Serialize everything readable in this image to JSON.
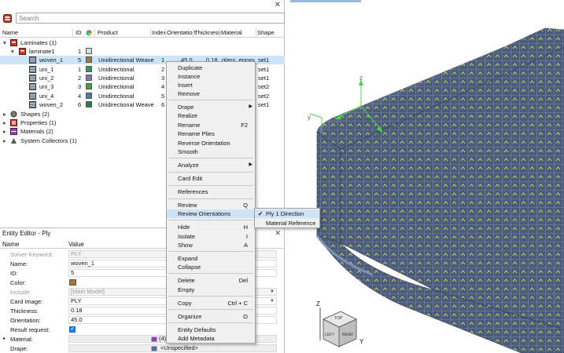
{
  "browser": {
    "close_glyph": "✕",
    "search_placeholder": "Search",
    "columns": [
      "Name",
      "ID",
      "Product",
      "Index",
      "Orientation",
      "Thickness",
      "Material",
      "Shape"
    ],
    "tree": {
      "laminates": "Laminates (1)",
      "laminate1": "laminate1",
      "laminate1_id": "1",
      "plies": [
        {
          "name": "woven_1",
          "id": "5",
          "product": "Unidirectional Weave",
          "index": "1",
          "orientation": "45.0",
          "thickness": "0.18",
          "material": "glass_epoxy",
          "shape": "set1",
          "color": "#a5793f"
        },
        {
          "name": "uni_1",
          "id": "1",
          "product": "Unidirectional",
          "index": "2",
          "orientation": "",
          "thickness": "",
          "material": "",
          "shape": "set1",
          "color": "#2f9a5a"
        },
        {
          "name": "uni_2",
          "id": "2",
          "product": "Unidirectional",
          "index": "3",
          "orientation": "",
          "thickness": "",
          "material": "",
          "shape": "set1",
          "color": "#8476b4"
        },
        {
          "name": "uni_3",
          "id": "3",
          "product": "Unidirectional",
          "index": "4",
          "orientation": "",
          "thickness": "",
          "material": "",
          "shape": "set2",
          "color": "#3fa635"
        },
        {
          "name": "uni_4",
          "id": "4",
          "product": "Unidirectional",
          "index": "5",
          "orientation": "",
          "thickness": "",
          "material": "",
          "shape": "set2",
          "color": "#5a76a8"
        },
        {
          "name": "woven_2",
          "id": "6",
          "product": "Unidirectional Weave",
          "index": "6",
          "orientation": "",
          "thickness": "",
          "material": "",
          "shape": "set1",
          "color": "#2a7a55"
        }
      ],
      "shapes": "Shapes (2)",
      "properties": "Properties (1)",
      "materials": "Materials (2)",
      "collectors": "System Collectors (1)"
    }
  },
  "editor": {
    "title": "Entity Editor - Ply",
    "close_glyph": "✕",
    "col_name": "Name",
    "col_value": "Value",
    "rows": [
      {
        "label": "Solver Keyword:",
        "value": "PLY"
      },
      {
        "label": "Name:",
        "value": "woven_1"
      },
      {
        "label": "ID:",
        "value": "5"
      },
      {
        "label": "Color:",
        "value": ""
      },
      {
        "label": "Include:",
        "value": "[Main Model]"
      },
      {
        "label": "Card Image:",
        "value": "PLY"
      },
      {
        "label": "Thickness:",
        "value": "0.18"
      },
      {
        "label": "Orientation:",
        "value": "45.0"
      },
      {
        "label": "Result request:",
        "value": ""
      },
      {
        "label": "Material:",
        "value": "(4)"
      },
      {
        "label": "Drape:",
        "value": "<Unspecified>"
      }
    ],
    "color_swatch": "#a5793f"
  },
  "context_menu": {
    "items": [
      {
        "label": "Duplicate",
        "key": ""
      },
      {
        "label": "Instance",
        "key": ""
      },
      {
        "label": "Insert",
        "key": ""
      },
      {
        "label": "Remove",
        "key": ""
      },
      {
        "label": "Drape",
        "key": ""
      },
      {
        "label": "Realize",
        "key": ""
      },
      {
        "label": "Rename",
        "key": "F2"
      },
      {
        "label": "Rename Plies",
        "key": ""
      },
      {
        "label": "Reverse Orientation",
        "key": ""
      },
      {
        "label": "Smooth",
        "key": ""
      },
      {
        "label": "Analyze",
        "key": ""
      },
      {
        "label": "Card Edit",
        "key": ""
      },
      {
        "label": "References",
        "key": ""
      },
      {
        "label": "Review",
        "key": "Q"
      },
      {
        "label": "Review Orientations",
        "key": ""
      },
      {
        "label": "Hide",
        "key": "H"
      },
      {
        "label": "Isolate",
        "key": "I"
      },
      {
        "label": "Show",
        "key": "A"
      },
      {
        "label": "Expand",
        "key": ""
      },
      {
        "label": "Collapse",
        "key": ""
      },
      {
        "label": "Delete",
        "key": "Del"
      },
      {
        "label": "Empty",
        "key": ""
      },
      {
        "label": "Copy",
        "key": "Ctrl + C"
      },
      {
        "label": "Organize",
        "key": "O"
      },
      {
        "label": "Entity Defaults",
        "key": ""
      },
      {
        "label": "Add Metadata",
        "key": ""
      }
    ],
    "arrow_glyph": "▶"
  },
  "submenu": {
    "check_glyph": "✔",
    "items": [
      "Ply 1 Direction",
      "Material Reference"
    ]
  },
  "viewport": {
    "axis_z": "z",
    "axis_y": "y",
    "axis_x": "x",
    "triad_z": "Z",
    "triad_y": "Y",
    "viewcube": [
      "TOP",
      "LEFT",
      "REAR"
    ],
    "mesh_color": "#4a5a7a",
    "arrow_color": "#d6e24a",
    "axis_color": "#4fd14f"
  }
}
